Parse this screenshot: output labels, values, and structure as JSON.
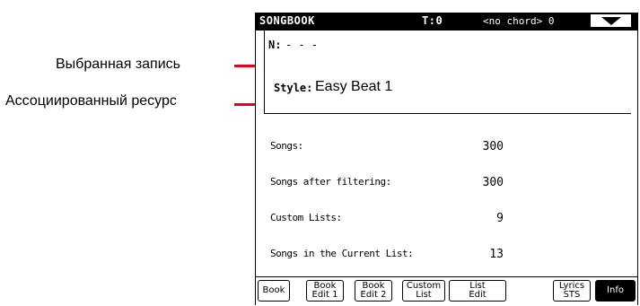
{
  "callouts": [
    {
      "label": "Выбранная запись"
    },
    {
      "label": "Ассоциированный ресурс"
    }
  ],
  "accent_color": "#e8001c",
  "titlebar": {
    "title": "SONGBOOK",
    "tempo": "T:0",
    "chord": "<no chord> 0",
    "menu_icon": "menu-triangle-icon"
  },
  "entry": {
    "n_label": "N:",
    "n_value": "- - -",
    "style_label": "Style:",
    "style_value": "Easy Beat 1"
  },
  "info": [
    {
      "label": "Songs:",
      "value": "300"
    },
    {
      "label": "Songs after filtering:",
      "value": "300"
    },
    {
      "label": "Custom Lists:",
      "value": "9"
    },
    {
      "label": "Songs in the Current List:",
      "value": "13"
    }
  ],
  "tabs": [
    {
      "label": "Book"
    },
    {
      "label": "Book\nEdit 1"
    },
    {
      "label": "Book\nEdit 2"
    },
    {
      "label": "Custom\nList"
    },
    {
      "label": "List\nEdit"
    },
    {
      "label": "Lyrics\nSTS"
    },
    {
      "label": "Info"
    }
  ]
}
